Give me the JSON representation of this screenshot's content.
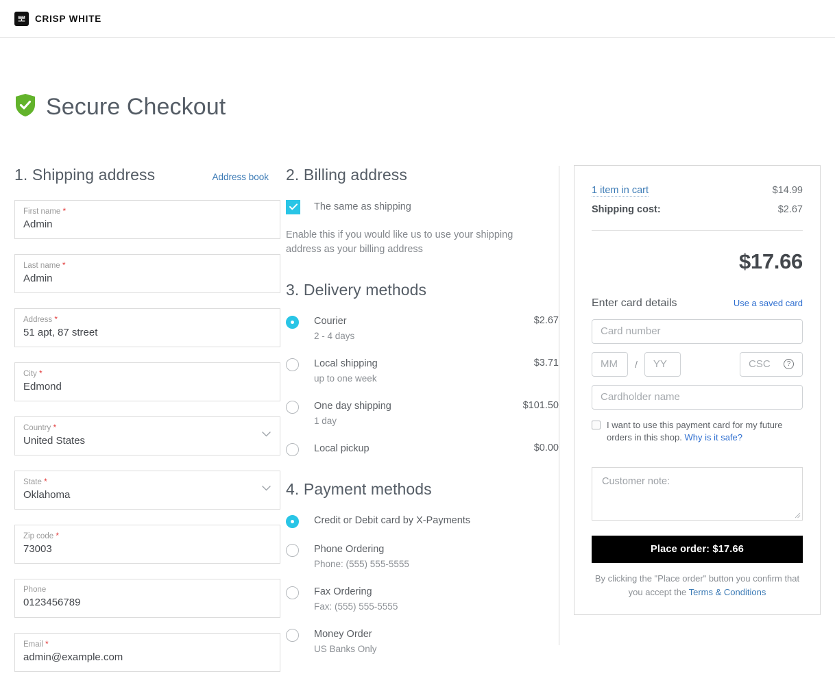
{
  "header": {
    "logo_text": "CRISP WHITE",
    "logo_icon": "store-front-icon"
  },
  "page": {
    "title": "Secure Checkout",
    "shield_icon": "shield-check-icon"
  },
  "shipping": {
    "heading": "1.  Shipping address",
    "address_book_label": "Address book",
    "fields": [
      {
        "label": "First name",
        "required": true,
        "value": "Admin",
        "type": "text"
      },
      {
        "label": "Last name",
        "required": true,
        "value": "Admin",
        "type": "text"
      },
      {
        "label": "Address",
        "required": true,
        "value": "51 apt, 87 street",
        "type": "text"
      },
      {
        "label": "City",
        "required": true,
        "value": "Edmond",
        "type": "text"
      },
      {
        "label": "Country",
        "required": true,
        "value": "United States",
        "type": "select"
      },
      {
        "label": "State",
        "required": true,
        "value": "Oklahoma",
        "type": "select"
      },
      {
        "label": "Zip code",
        "required": true,
        "value": "73003",
        "type": "text"
      },
      {
        "label": "Phone",
        "required": false,
        "value": "0123456789",
        "type": "text"
      },
      {
        "label": "Email",
        "required": true,
        "value": "admin@example.com",
        "type": "text"
      }
    ]
  },
  "billing": {
    "heading": "2.  Billing address",
    "same_as_shipping_label": "The same as shipping",
    "same_as_shipping_checked": true,
    "helper_text": "Enable this if you would like us to use your shipping address as your billing address"
  },
  "delivery": {
    "heading": "3.  Delivery methods",
    "options": [
      {
        "title": "Courier",
        "sub": "2 - 4 days",
        "price": "$2.67",
        "selected": true
      },
      {
        "title": "Local shipping",
        "sub": "up to one week",
        "price": "$3.71",
        "selected": false
      },
      {
        "title": "One day shipping",
        "sub": "1 day",
        "price": "$101.50",
        "selected": false
      },
      {
        "title": "Local pickup",
        "sub": "",
        "price": "$0.00",
        "selected": false
      }
    ]
  },
  "payment": {
    "heading": "4.  Payment methods",
    "options": [
      {
        "title": "Credit or Debit card by X-Payments",
        "sub": "",
        "selected": true
      },
      {
        "title": "Phone Ordering",
        "sub": "Phone: (555) 555-5555",
        "selected": false
      },
      {
        "title": "Fax Ordering",
        "sub": "Fax: (555) 555-5555",
        "selected": false
      },
      {
        "title": "Money Order",
        "sub": "US Banks Only",
        "selected": false
      }
    ]
  },
  "summary": {
    "cart_link_label": "1 item in cart",
    "cart_value": "$14.99",
    "shipping_label": "Shipping cost:",
    "shipping_value": "$2.67",
    "grand_total": "$17.66",
    "card": {
      "title": "Enter card details",
      "saved_card_link": "Use a saved card",
      "card_number_placeholder": "Card number",
      "month_placeholder": "MM",
      "separator": "/",
      "year_placeholder": "YY",
      "csc_placeholder": "CSC",
      "csc_help_icon": "question-mark-circle-icon",
      "cardholder_placeholder": "Cardholder name",
      "save_card_text": "I want to use this payment card for my future orders in this shop.",
      "save_card_link": "Why is it safe?",
      "save_card_checked": false
    },
    "note_placeholder": "Customer note:",
    "place_order_label": "Place order: $17.66",
    "terms_prefix": "By clicking the \"Place order\" button you confirm that you accept the",
    "terms_link": "Terms & Conditions"
  },
  "colors": {
    "accent_cyan": "#29c5e6",
    "shield_green": "#62b32b",
    "link_blue": "#3b7ab5",
    "required_red": "#e23b3b",
    "button_black": "#000000"
  }
}
